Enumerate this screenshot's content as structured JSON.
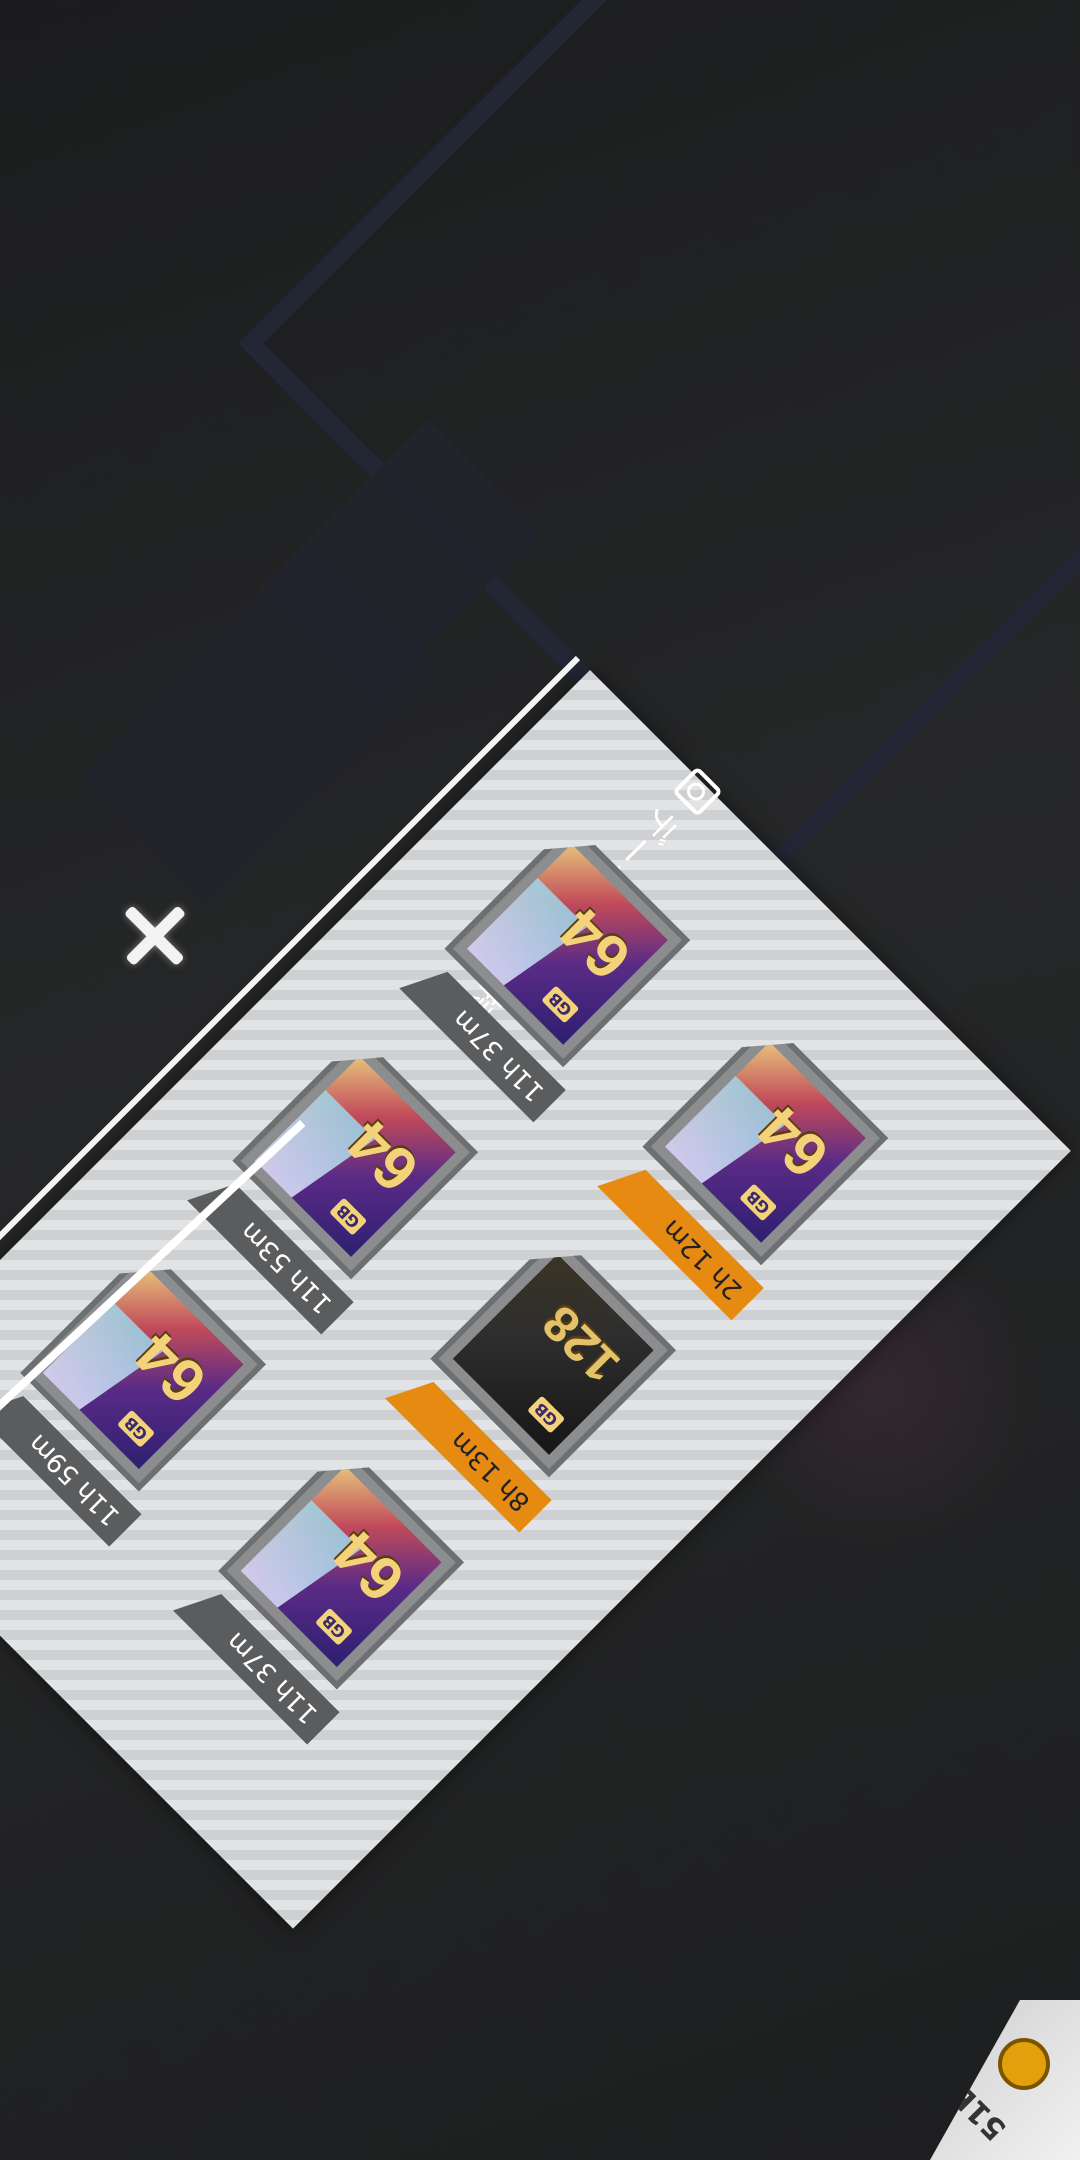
{
  "panel": {
    "title": "データチップ所持"
  },
  "chips": [
    {
      "timer": "11h 37m",
      "value": "64",
      "unit": "GB",
      "variant": "purple",
      "timer_color": "gray"
    },
    {
      "timer": "11h 53m",
      "value": "64",
      "unit": "GB",
      "variant": "purple",
      "timer_color": "gray"
    },
    {
      "timer": "2h 12m",
      "value": "64",
      "unit": "GB",
      "variant": "purple",
      "timer_color": "orange"
    },
    {
      "timer": "11h 59m",
      "value": "64",
      "unit": "GB",
      "variant": "purple",
      "timer_color": "gray"
    },
    {
      "timer": "8h 13m",
      "value": "128",
      "unit": "GB",
      "variant": "black",
      "timer_color": "orange"
    },
    {
      "timer": "11h 37m",
      "value": "64",
      "unit": "GB",
      "variant": "purple",
      "timer_color": "gray"
    }
  ],
  "corner": {
    "text": "51E"
  },
  "colors": {
    "accent": "#e68a12",
    "panel": "#d8d9db"
  }
}
